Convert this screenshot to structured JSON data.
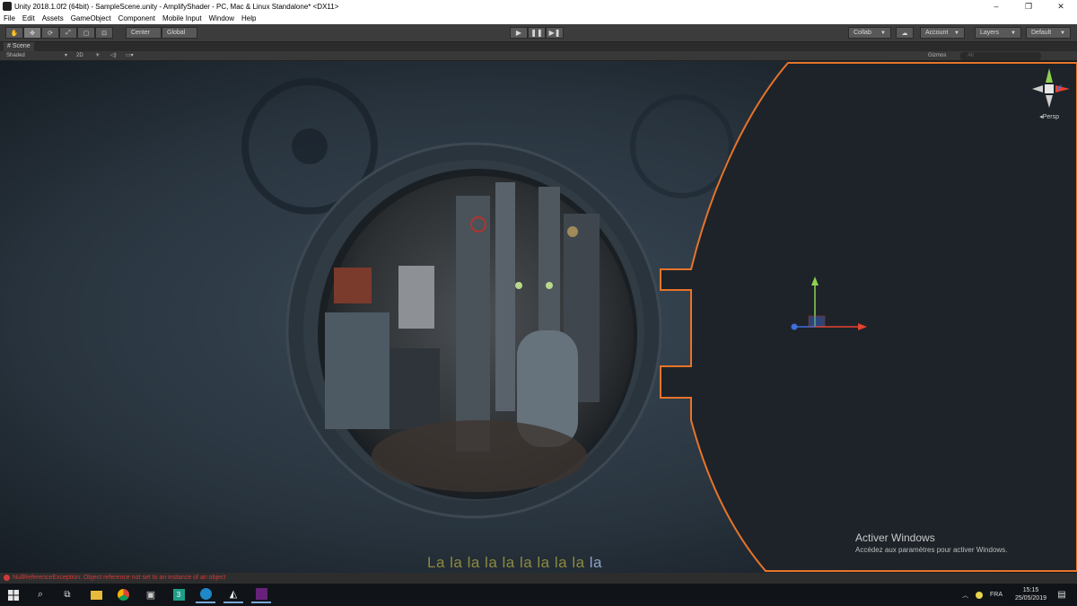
{
  "window": {
    "title": "Unity 2018.1.0f2 (64bit) - SampleScene.unity - AmplifyShader - PC, Mac & Linux Standalone* <DX11>",
    "minimize": "–",
    "maximize": "❐",
    "close": "✕"
  },
  "menu": [
    "File",
    "Edit",
    "Assets",
    "GameObject",
    "Component",
    "Mobile Input",
    "Window",
    "Help"
  ],
  "toolbar": {
    "tools": [
      "hand-tool",
      "move-tool",
      "rotate-tool",
      "scale-tool",
      "rect-tool",
      "transform-tool"
    ],
    "pivot_label": "Center",
    "space_label": "Global",
    "play": "▶",
    "pause": "❚❚",
    "step": "▶❚",
    "collab_label": "Collab",
    "account_label": "Account",
    "layers_label": "Layers",
    "layout_label": "Default"
  },
  "scene": {
    "tab_label": "Scene",
    "shading_mode": "Shaded",
    "mode_2d": "2D",
    "gizmos_label": "Gizmos",
    "search_placeholder": "All",
    "projection": "Persp"
  },
  "overlay": {
    "activation_title": "Activer Windows",
    "activation_sub": "Accédez aux paramètres pour activer Windows.",
    "lyrics": "La la la la la la la la la",
    "lyrics_last": "la"
  },
  "status": {
    "error_text": "NullReferenceException: Object reference not set to an instance of an object"
  },
  "taskbar": {
    "language": "FRA",
    "time": "15:15",
    "date": "25/05/2019"
  },
  "colors": {
    "selection_outline": "#e8742a",
    "axis_x": "#e8412f",
    "axis_y": "#8fd14f",
    "axis_z": "#3f6fd8"
  }
}
